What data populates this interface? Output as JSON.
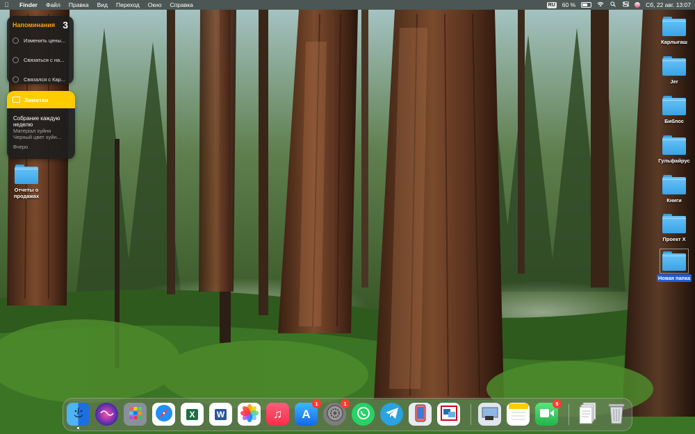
{
  "menubar": {
    "app_name": "Finder",
    "menus": [
      "Файл",
      "Правка",
      "Вид",
      "Переход",
      "Окно",
      "Справка"
    ],
    "input_source": "RU",
    "battery_percent_label": "60 %",
    "battery_level": 0.6,
    "datetime": "Сб, 22 авг.  13:07"
  },
  "widgets": {
    "reminders": {
      "title": "Напоминания",
      "count": "3",
      "items": [
        "Изменить цены...",
        "Связаться с на...",
        "Связался с Кар..."
      ]
    },
    "notes": {
      "header": "Заметки",
      "note_title": "Собрание каждую неделю",
      "note_lines": [
        "Матерiал хуйня",
        "Черный  цвет хуйн..."
      ],
      "note_date": "Вчеро"
    }
  },
  "desktop": {
    "left_items": [
      {
        "label": "Отчеты о продажах"
      }
    ],
    "right_items": [
      {
        "label": "Карлыгаш"
      },
      {
        "label": "Jer"
      },
      {
        "label": "Библос"
      },
      {
        "label": "Гульфайрус"
      },
      {
        "label": "Книги"
      },
      {
        "label": "Проект Х"
      },
      {
        "label": "Новая папка",
        "selected": true
      }
    ]
  },
  "dock": {
    "apps": [
      {
        "name": "Finder",
        "icon": "finder-icon",
        "color": "#1d8cf0"
      },
      {
        "name": "Siri",
        "icon": "siri-icon",
        "color": "#5b2fb0"
      },
      {
        "name": "Launchpad",
        "icon": "launchpad-icon",
        "color": "#8a9099"
      },
      {
        "name": "Safari",
        "icon": "safari-icon",
        "color": "#1e90ff"
      },
      {
        "name": "Excel",
        "icon": "excel-icon",
        "color": "#ffffff",
        "glyph": "X"
      },
      {
        "name": "Word",
        "icon": "word-icon",
        "color": "#ffffff",
        "glyph": "W"
      },
      {
        "name": "Photos",
        "icon": "photos-icon",
        "color": "#ffffff"
      },
      {
        "name": "Music",
        "icon": "music-icon",
        "color": "#fa2d48",
        "glyph": "♫"
      },
      {
        "name": "App Store",
        "icon": "app-store-icon",
        "color": "#1a8cff",
        "glyph": "A",
        "badge": "1"
      },
      {
        "name": "System Preferences",
        "icon": "system-preferences-icon",
        "color": "#7d7d7d",
        "badge": "1"
      },
      {
        "name": "WhatsApp",
        "icon": "whatsapp-icon",
        "color": "#25d366"
      },
      {
        "name": "Telegram",
        "icon": "telegram-icon",
        "color": "#2aa3e0"
      },
      {
        "name": "iPhone Backup",
        "icon": "iphone-backup-icon",
        "color": "#e9e9ee"
      },
      {
        "name": "Remote Desktop",
        "icon": "remote-desktop-icon",
        "color": "#ffffff"
      },
      {
        "name": "Preview",
        "icon": "preview-icon",
        "color": "#dfe6ee"
      },
      {
        "name": "Notes",
        "icon": "notes-icon",
        "color": "#fff7d0"
      },
      {
        "name": "FaceTime",
        "icon": "facetime-icon",
        "color": "#2fd158",
        "badge": "5"
      },
      {
        "name": "Documents",
        "icon": "documents-stack-icon",
        "color": "#e8e8e8"
      },
      {
        "name": "Trash",
        "icon": "trash-icon",
        "color": "#cfd3d6"
      }
    ]
  }
}
